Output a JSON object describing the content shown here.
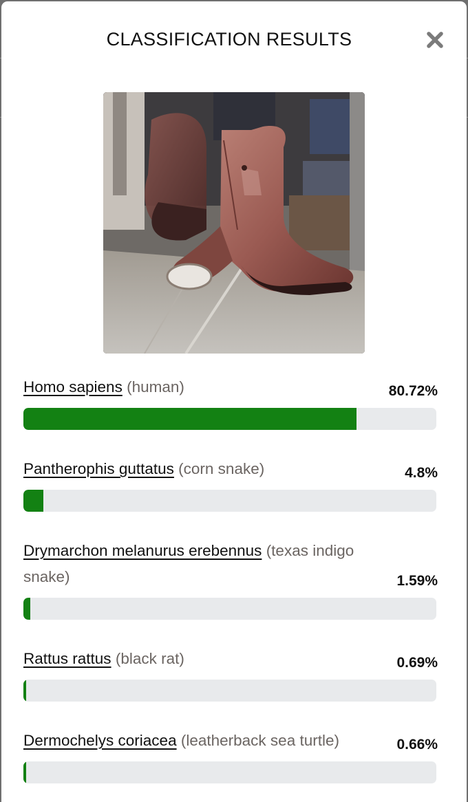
{
  "modal": {
    "title": "CLASSIFICATION RESULTS",
    "close_icon": "close-icon"
  },
  "image": {
    "subject": "cowboy boot"
  },
  "colors": {
    "bar_fill": "#138113",
    "bar_track": "#e8eaec"
  },
  "results": [
    {
      "scientific": "Homo sapiens",
      "common": "(human)",
      "percent": "80.72%",
      "value": 80.72
    },
    {
      "scientific": "Pantherophis guttatus",
      "common": "(corn snake)",
      "percent": "4.8%",
      "value": 4.8
    },
    {
      "scientific": "Drymarchon melanurus erebennus",
      "common": "(texas indigo snake)",
      "percent": "1.59%",
      "value": 1.59
    },
    {
      "scientific": "Rattus rattus",
      "common": "(black rat)",
      "percent": "0.69%",
      "value": 0.69
    },
    {
      "scientific": "Dermochelys coriacea",
      "common": "(leatherback sea turtle)",
      "percent": "0.66%",
      "value": 0.66
    }
  ]
}
